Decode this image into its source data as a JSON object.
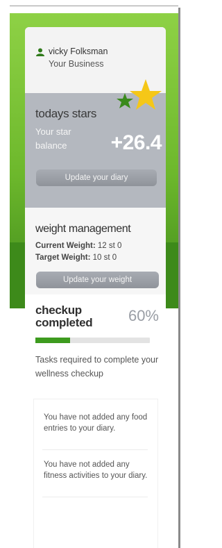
{
  "user": {
    "name": "vicky Folksman",
    "business": "Your Business"
  },
  "stars": {
    "title": "todays stars",
    "balance_label": "Your star balance",
    "balance_value": "+26.4",
    "button_label": "Update your diary"
  },
  "weight": {
    "title": "weight management",
    "current_label": "Current Weight:",
    "current_value": "12 st 0",
    "target_label": "Target Weight:",
    "target_value": "10 st 0",
    "button_label": "Update your weight"
  },
  "checkup": {
    "title": "checkup completed",
    "percent_text": "60%",
    "progress_fraction": 0.3,
    "description": "Tasks required to complete your wellness checkup",
    "tasks": [
      "You have not added any food entries to your diary.",
      "You have not added any fitness activities to your diary."
    ]
  },
  "colors": {
    "green": "#6db82c",
    "dark_green": "#3d8a1a",
    "progress_green": "#3d9b1e",
    "star_gold": "#f5c718",
    "star_green": "#3a8a1c",
    "panel_gray": "#b4b8bf"
  },
  "icons": {
    "user": "person-icon",
    "stars": "stars-icon"
  }
}
